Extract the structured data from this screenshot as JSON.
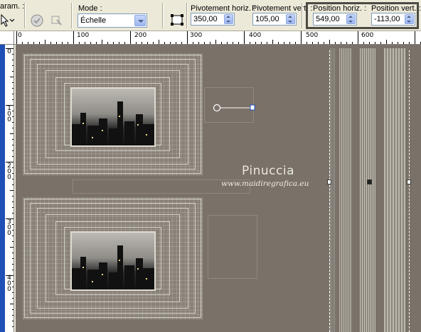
{
  "toolbar": {
    "params_label": "aram. :",
    "mode": {
      "label": "Mode :",
      "value": "Échelle"
    },
    "rot_h": {
      "label": "Pivotement horiz. :",
      "value": "350,00"
    },
    "rot_v": {
      "label": "Pivotement vert. :",
      "value": "105,00"
    },
    "pos_h": {
      "label": "Position horiz. :",
      "value": "549,00"
    },
    "pos_v": {
      "label": "Position vert. :",
      "value": "-113,00"
    },
    "icons": [
      "pointer-tool-icon",
      "apply-icon",
      "transform-icon",
      "reset-icon"
    ]
  },
  "ruler": {
    "h_marks": [
      "0",
      "100",
      "200",
      "300",
      "400",
      "500",
      "600"
    ],
    "v_marks": [
      "0",
      "100",
      "200",
      "300",
      "400"
    ]
  },
  "canvas": {
    "watermark_name": "Pinuccia",
    "watermark_url": "www.maidiregrafica.eu",
    "colors": {
      "background": "#7a7268",
      "highlight_box": "#4b4b44",
      "ruler_strip": "#1e4fb4"
    }
  }
}
